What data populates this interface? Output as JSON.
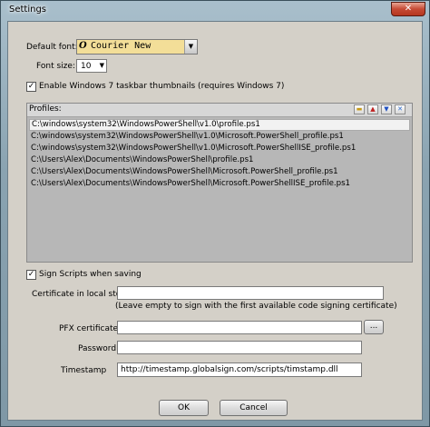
{
  "window": {
    "title": "Settings",
    "close_glyph": "✕"
  },
  "font": {
    "label": "Default font:",
    "value": "Courier New",
    "glyph": "O",
    "size_label": "Font size:",
    "size_value": "10"
  },
  "taskbar_option": {
    "label": "Enable Windows 7 taskbar thumbnails (requires Windows 7)",
    "checked": true
  },
  "profiles": {
    "title": "Profiles:",
    "items": [
      "C:\\windows\\system32\\WindowsPowerShell\\v1.0\\profile.ps1",
      "C:\\windows\\system32\\WindowsPowerShell\\v1.0\\Microsoft.PowerShell_profile.ps1",
      "C:\\windows\\system32\\WindowsPowerShell\\v1.0\\Microsoft.PowerShellISE_profile.ps1",
      "C:\\Users\\Alex\\Documents\\WindowsPowerShell\\profile.ps1",
      "C:\\Users\\Alex\\Documents\\WindowsPowerShell\\Microsoft.PowerShell_profile.ps1",
      "C:\\Users\\Alex\\Documents\\WindowsPowerShell\\Microsoft.PowerShellISE_profile.ps1"
    ],
    "selected_index": 0,
    "toolbar": [
      "folder-open-icon",
      "up-arrow-icon",
      "down-arrow-icon",
      "remove-icon"
    ]
  },
  "signing": {
    "checkbox_label": "Sign Scripts when saving",
    "checked": true,
    "cert_label": "Certificate in local store:",
    "cert_value": "",
    "cert_hint": "(Leave empty to sign with the first available code signing certificate)",
    "pfx_label": "PFX certificate:",
    "pfx_value": "",
    "browse_label": "...",
    "password_label": "Password:",
    "password_value": "",
    "timestamp_label": "Timestamp",
    "timestamp_value": "http://timestamp.globalsign.com/scripts/timstamp.dll"
  },
  "buttons": {
    "ok": "OK",
    "cancel": "Cancel"
  },
  "colors": {
    "font_box": "#f3de98",
    "close_button": "#c64a34"
  }
}
